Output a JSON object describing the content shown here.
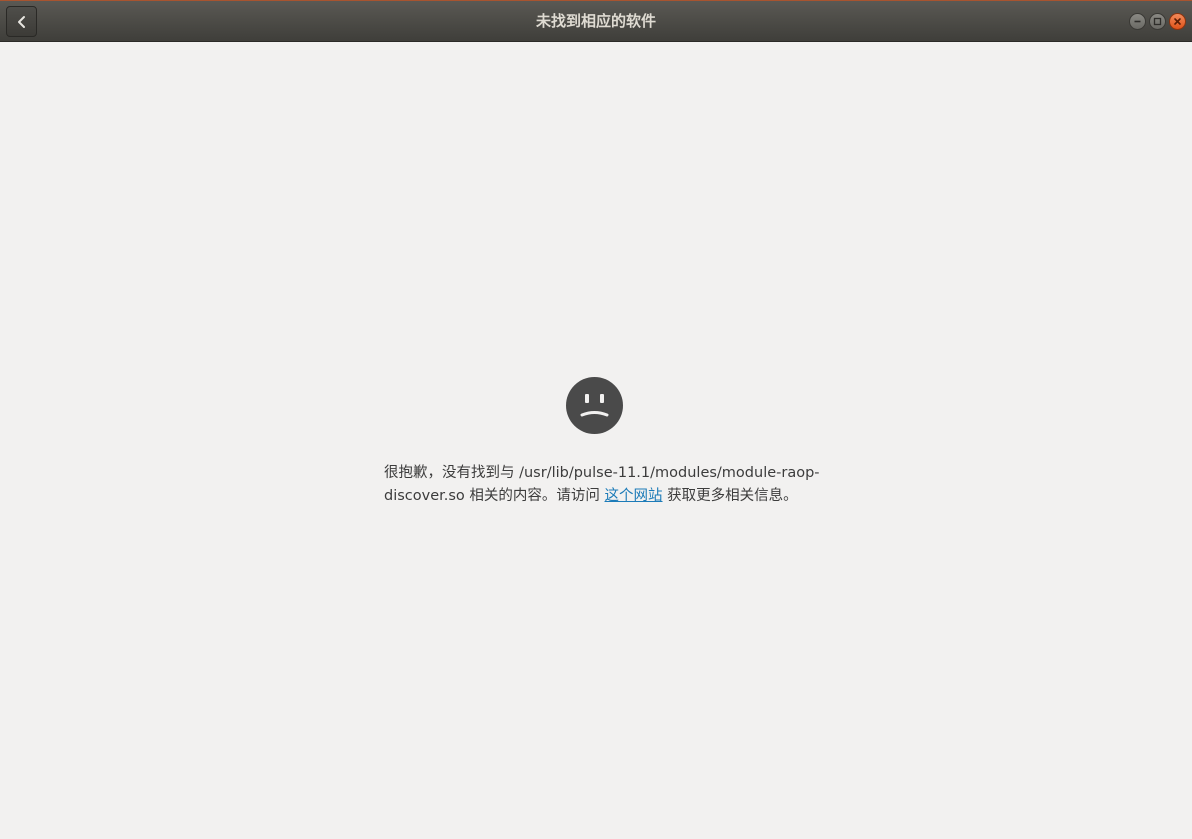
{
  "window": {
    "title": "未找到相应的软件"
  },
  "titlebar": {
    "back_icon": "chevron-left-icon",
    "wm_buttons": [
      "minimize-icon",
      "maximize-icon",
      "close-icon"
    ]
  },
  "empty_state": {
    "icon": "sad-face-icon",
    "message_line1": "很抱歉，没有找到与 /usr/lib/pulse-11.1/modules/module-raop-",
    "message_line2_prefix": "discover.so 相关的内容。请访问 ",
    "link_text": "这个网站",
    "message_line2_suffix": " 获取更多相关信息。"
  },
  "colors": {
    "titlebar": "#3f3e3a",
    "background": "#f2f1f0",
    "link": "#1c7bb8",
    "close_button": "#e0531a",
    "face": "#4a4a4a"
  }
}
